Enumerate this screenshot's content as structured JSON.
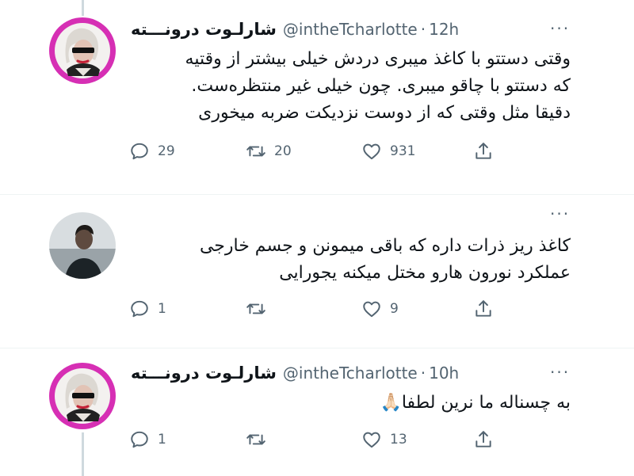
{
  "tweets": [
    {
      "name": "شارلـوت درونـــته",
      "handle": "@intheTcharlotte",
      "time": "12h",
      "lines": [
        "وقتی دستتو با کاغذ میبری دردش خیلی بیشتر از وقتیه",
        "که دستتو با چاقو میبری. چون خیلی غیر منتظره‌ست.",
        "دقیقا مثل وقتی که از دوست نزدیکت ضربه میخوری"
      ],
      "replies": "29",
      "retweets": "20",
      "likes": "931"
    },
    {
      "lines": [
        "کاغذ ریز ذرات داره که باقی میمونن و جسم خارجی",
        "عملکرد نورون هارو مختل میکنه یجورایی"
      ],
      "replies": "1",
      "retweets": "",
      "likes": "9"
    },
    {
      "name": "شارلـوت درونـــته",
      "handle": "@intheTcharlotte",
      "time": "10h",
      "lines": [
        "به چسناله ما نرین لطفا🙏🏻"
      ],
      "replies": "1",
      "retweets": "",
      "likes": "13"
    }
  ],
  "ui": {
    "more": "···",
    "dot": "·"
  },
  "colors": {
    "avatar_ring": "#d62fb4",
    "text": "#0f1419",
    "muted": "#536471"
  },
  "icons": [
    "reply-icon",
    "retweet-icon",
    "like-icon",
    "share-icon",
    "more-icon"
  ]
}
